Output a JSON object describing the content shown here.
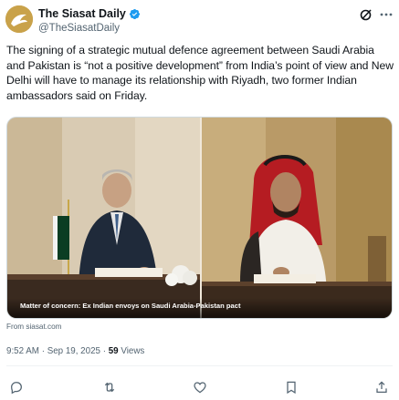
{
  "account": {
    "display_name": "The Siasat Daily",
    "handle": "@TheSiasatDaily",
    "avatar_icon": "siasat-logo",
    "verified_icon": "verified-badge-icon",
    "verified_color": "#1d9bf0",
    "grok_icon": "grok-icon",
    "more_icon": "more-options-icon"
  },
  "tweet": {
    "text": "The signing of a strategic mutual defence agreement between Saudi Arabia and Pakistan is “not a positive development” from India’s point of view and New Delhi will have to manage its relationship with Riyadh, two former Indian ambassadors said on Friday."
  },
  "card": {
    "caption": "Matter of concern: Ex Indian envoys on Saudi Arabia-Pakistan pact",
    "source": "From siasat.com"
  },
  "meta": {
    "time": "9:52 AM",
    "separator": "·",
    "date": "Sep 19, 2025",
    "views_count": "59",
    "views_label": "Views"
  },
  "actions": [
    {
      "name": "reply",
      "icon": "reply-icon"
    },
    {
      "name": "repost",
      "icon": "repost-icon"
    },
    {
      "name": "like",
      "icon": "like-icon"
    },
    {
      "name": "bookmark",
      "icon": "bookmark-icon"
    },
    {
      "name": "share",
      "icon": "share-icon"
    }
  ],
  "colors": {
    "text_primary": "#0f1419",
    "text_secondary": "#536471",
    "border": "#cfd9de",
    "avatar_bg": "#c9a24a"
  }
}
